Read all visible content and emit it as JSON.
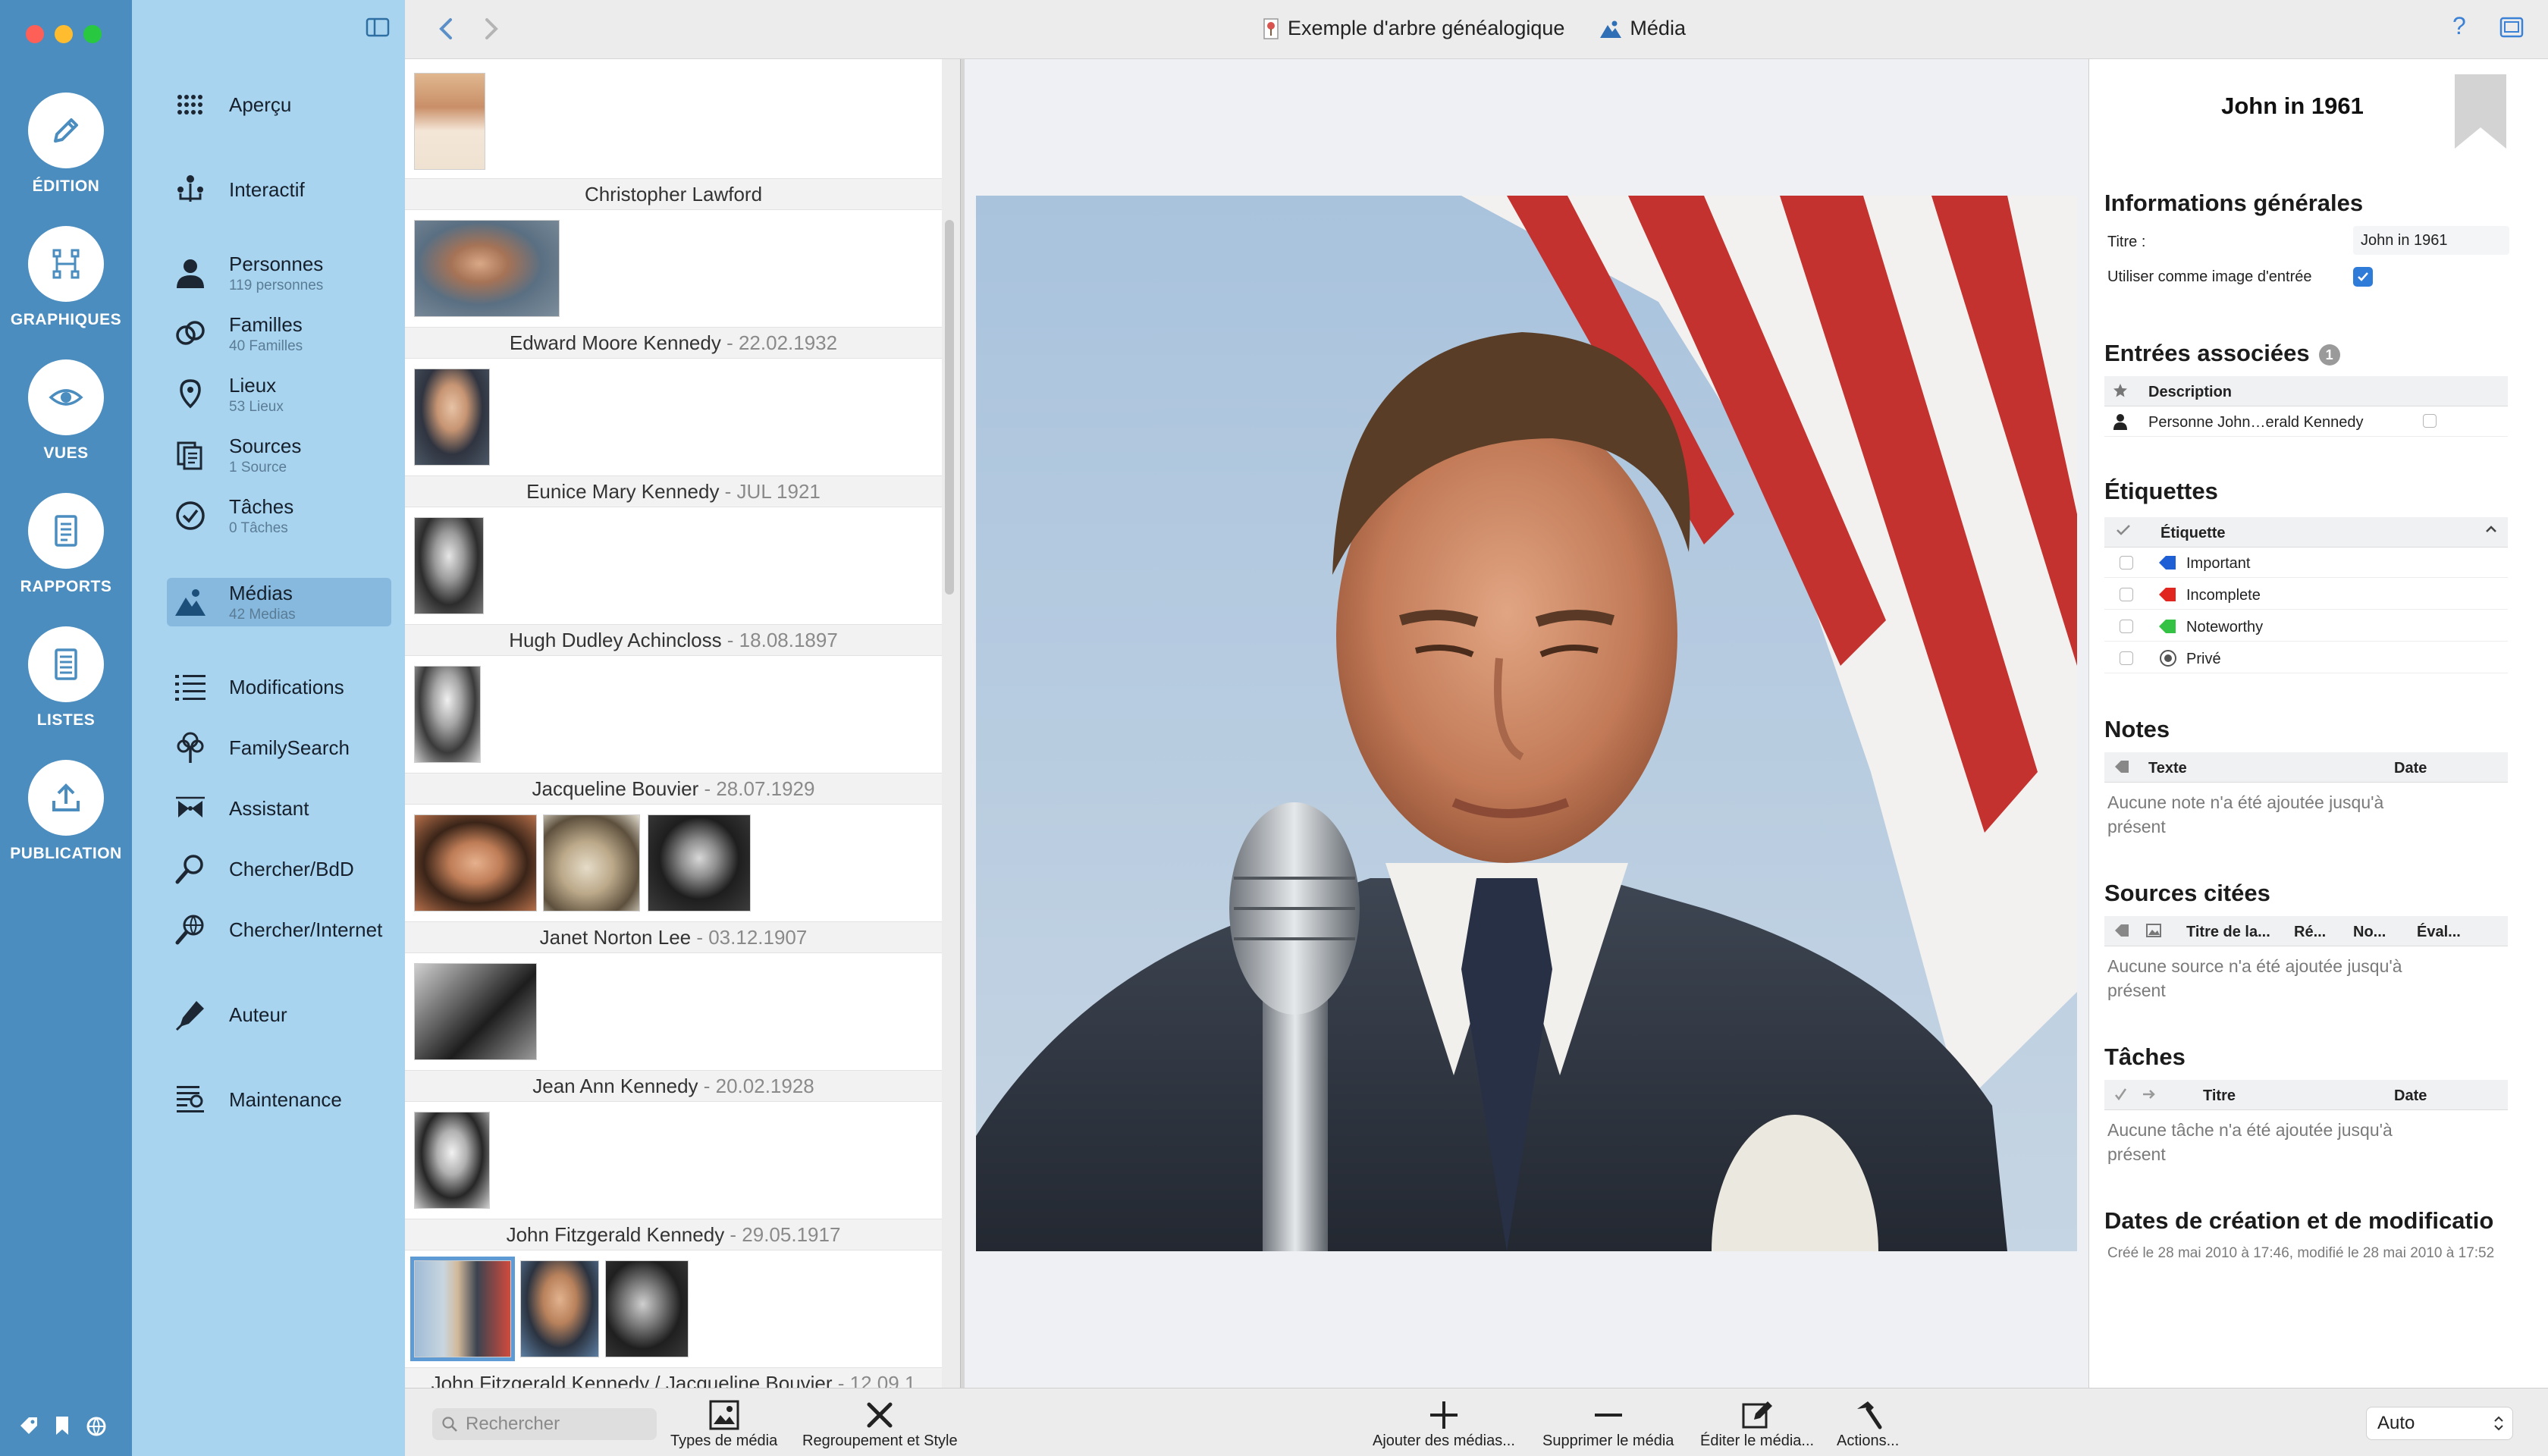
{
  "window": {
    "traffic_lights": [
      "#fe5f57",
      "#febc2e",
      "#28c840"
    ]
  },
  "rail": {
    "items": [
      {
        "label": "ÉDITION",
        "icon": "pencil-icon"
      },
      {
        "label": "GRAPHIQUES",
        "icon": "chart-tree-icon"
      },
      {
        "label": "VUES",
        "icon": "eye-icon"
      },
      {
        "label": "RAPPORTS",
        "icon": "report-icon"
      },
      {
        "label": "LISTES",
        "icon": "list-icon"
      },
      {
        "label": "PUBLICATION",
        "icon": "upload-icon"
      }
    ],
    "bottom_icons": [
      "tag-icon",
      "bookmark-icon",
      "globe-icon"
    ]
  },
  "nav": {
    "items": [
      {
        "label": "Aperçu",
        "count": ""
      },
      {
        "label": "Interactif",
        "count": ""
      },
      {
        "label": "Personnes",
        "count": "119 personnes"
      },
      {
        "label": "Familles",
        "count": "40 Familles"
      },
      {
        "label": "Lieux",
        "count": "53 Lieux"
      },
      {
        "label": "Sources",
        "count": "1 Source"
      },
      {
        "label": "Tâches",
        "count": "0 Tâches"
      },
      {
        "label": "Médias",
        "count": "42 Medias"
      },
      {
        "label": "Modifications",
        "count": ""
      },
      {
        "label": "FamilySearch",
        "count": ""
      },
      {
        "label": "Assistant",
        "count": ""
      },
      {
        "label": "Chercher/BdD",
        "count": ""
      },
      {
        "label": "Chercher/Internet",
        "count": ""
      },
      {
        "label": "Auteur",
        "count": ""
      },
      {
        "label": "Maintenance",
        "count": ""
      }
    ]
  },
  "toolbar": {
    "breadcrumb_tree": "Exemple d'arbre généalogique",
    "breadcrumb_section": "Média",
    "help": "?"
  },
  "media_list": {
    "groups": [
      {
        "name": "Christopher Lawford",
        "date": ""
      },
      {
        "name": "Edward Moore Kennedy",
        "date": " - 22.02.1932"
      },
      {
        "name": "Eunice Mary Kennedy",
        "date": " - JUL 1921"
      },
      {
        "name": "Hugh Dudley Achincloss",
        "date": " - 18.08.1897"
      },
      {
        "name": "Jacqueline Bouvier",
        "date": " - 28.07.1929"
      },
      {
        "name": "Janet Norton Lee",
        "date": " - 03.12.1907"
      },
      {
        "name": "Jean Ann Kennedy",
        "date": " - 20.02.1928"
      },
      {
        "name": "John Fitzgerald Kennedy",
        "date": " - 29.05.1917"
      },
      {
        "name": "John Fitzgerald Kennedy / Jacqueline Bouvier",
        "date": " - 12.09.1"
      }
    ]
  },
  "inspector": {
    "title": "John in 1961",
    "general": {
      "heading": "Informations générales",
      "title_label": "Titre :",
      "title_value": "John in 1961",
      "entry_image_label": "Utiliser comme image d'entrée",
      "entry_image_checked": true
    },
    "associated": {
      "heading": "Entrées associées",
      "count": "1",
      "col_description": "Description",
      "rows": [
        {
          "text": "Personne John…erald Kennedy"
        }
      ]
    },
    "labels": {
      "heading": "Étiquettes",
      "col": "Étiquette",
      "items": [
        {
          "name": "Important",
          "color": "#1f5fd6"
        },
        {
          "name": "Incomplete",
          "color": "#e0261f"
        },
        {
          "name": "Noteworthy",
          "color": "#33c243"
        },
        {
          "name": "Privé",
          "color": "#555555"
        }
      ]
    },
    "notes": {
      "heading": "Notes",
      "col_text": "Texte",
      "col_date": "Date",
      "empty": "Aucune note n'a été ajoutée jusqu'à présent"
    },
    "sources": {
      "heading": "Sources citées",
      "col_title": "Titre de la...",
      "col_ref": "Ré...",
      "col_no": "No...",
      "col_eval": "Éval...",
      "empty": "Aucune source n'a été ajoutée jusqu'à présent"
    },
    "tasks": {
      "heading": "Tâches",
      "col_title": "Titre",
      "col_date": "Date",
      "empty": "Aucune tâche n'a été ajoutée jusqu'à présent"
    },
    "dates": {
      "heading": "Dates de création et de modificatio",
      "text": "Créé le 28 mai 2010 à 17:46, modifié le 28 mai 2010 à 17:52"
    }
  },
  "bottom": {
    "search_placeholder": "Rechercher",
    "media_types": "Types de média",
    "grouping_style": "Regroupement et Style",
    "add_media": "Ajouter des médias...",
    "delete_media": "Supprimer le média",
    "edit_media": "Éditer le média...",
    "actions": "Actions...",
    "auto": "Auto"
  }
}
